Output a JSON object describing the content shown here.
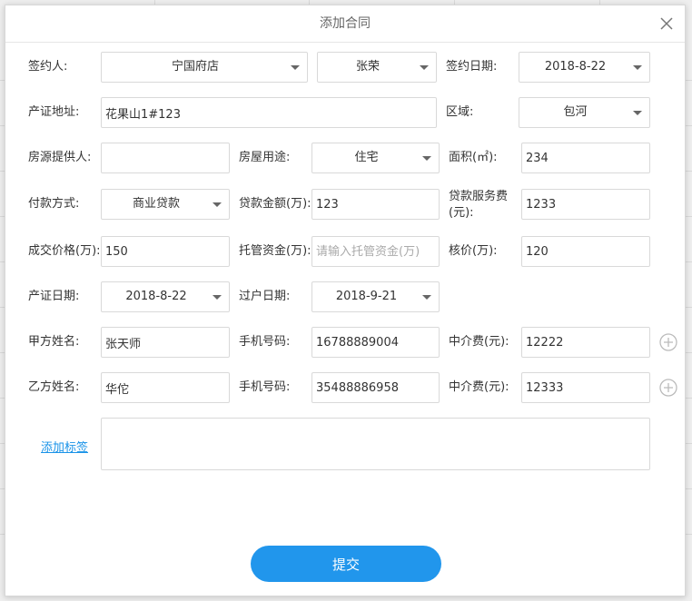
{
  "dialog": {
    "title": "添加合同",
    "submit_label": "提交"
  },
  "form": {
    "signer_label": "签约人:",
    "signer_store": "宁国府店",
    "signer_name": "张荣",
    "sign_date_label": "签约日期:",
    "sign_date": "2018-8-22",
    "cert_address_label": "产证地址:",
    "cert_address": "花果山1#123",
    "district_label": "区域:",
    "district": "包河",
    "provider_label": "房源提供人:",
    "provider": "",
    "usage_label": "房屋用途:",
    "usage": "住宅",
    "area_label": "面积(㎡):",
    "area": "234",
    "payment_label": "付款方式:",
    "payment": "商业贷款",
    "loan_amount_label": "贷款金额(万):",
    "loan_amount": "123",
    "loan_fee_label": "贷款服务费(元):",
    "loan_fee": "1233",
    "deal_price_label": "成交价格(万):",
    "deal_price": "150",
    "escrow_label": "托管资金(万):",
    "escrow": "",
    "escrow_placeholder": "请输入托管资金(万)",
    "appraisal_label": "核价(万):",
    "appraisal": "120",
    "cert_date_label": "产证日期:",
    "cert_date": "2018-8-22",
    "transfer_date_label": "过户日期:",
    "transfer_date": "2018-9-21",
    "party_a_label": "甲方姓名:",
    "party_a": "张天师",
    "party_a_phone_label": "手机号码:",
    "party_a_phone": "16788889004",
    "party_a_fee_label": "中介费(元):",
    "party_a_fee": "12222",
    "party_b_label": "乙方姓名:",
    "party_b": "华佗",
    "party_b_phone_label": "手机号码:",
    "party_b_phone": "35488886958",
    "party_b_fee_label": "中介费(元):",
    "party_b_fee": "12333",
    "add_tag_label": "添加标签",
    "notes": ""
  },
  "icons": {
    "close": "close-icon",
    "plus": "plus-circle-icon",
    "caret": "chevron-down-icon"
  },
  "colors": {
    "accent": "#2196ec",
    "link": "#1a93e8",
    "border": "#d9d9d9"
  }
}
